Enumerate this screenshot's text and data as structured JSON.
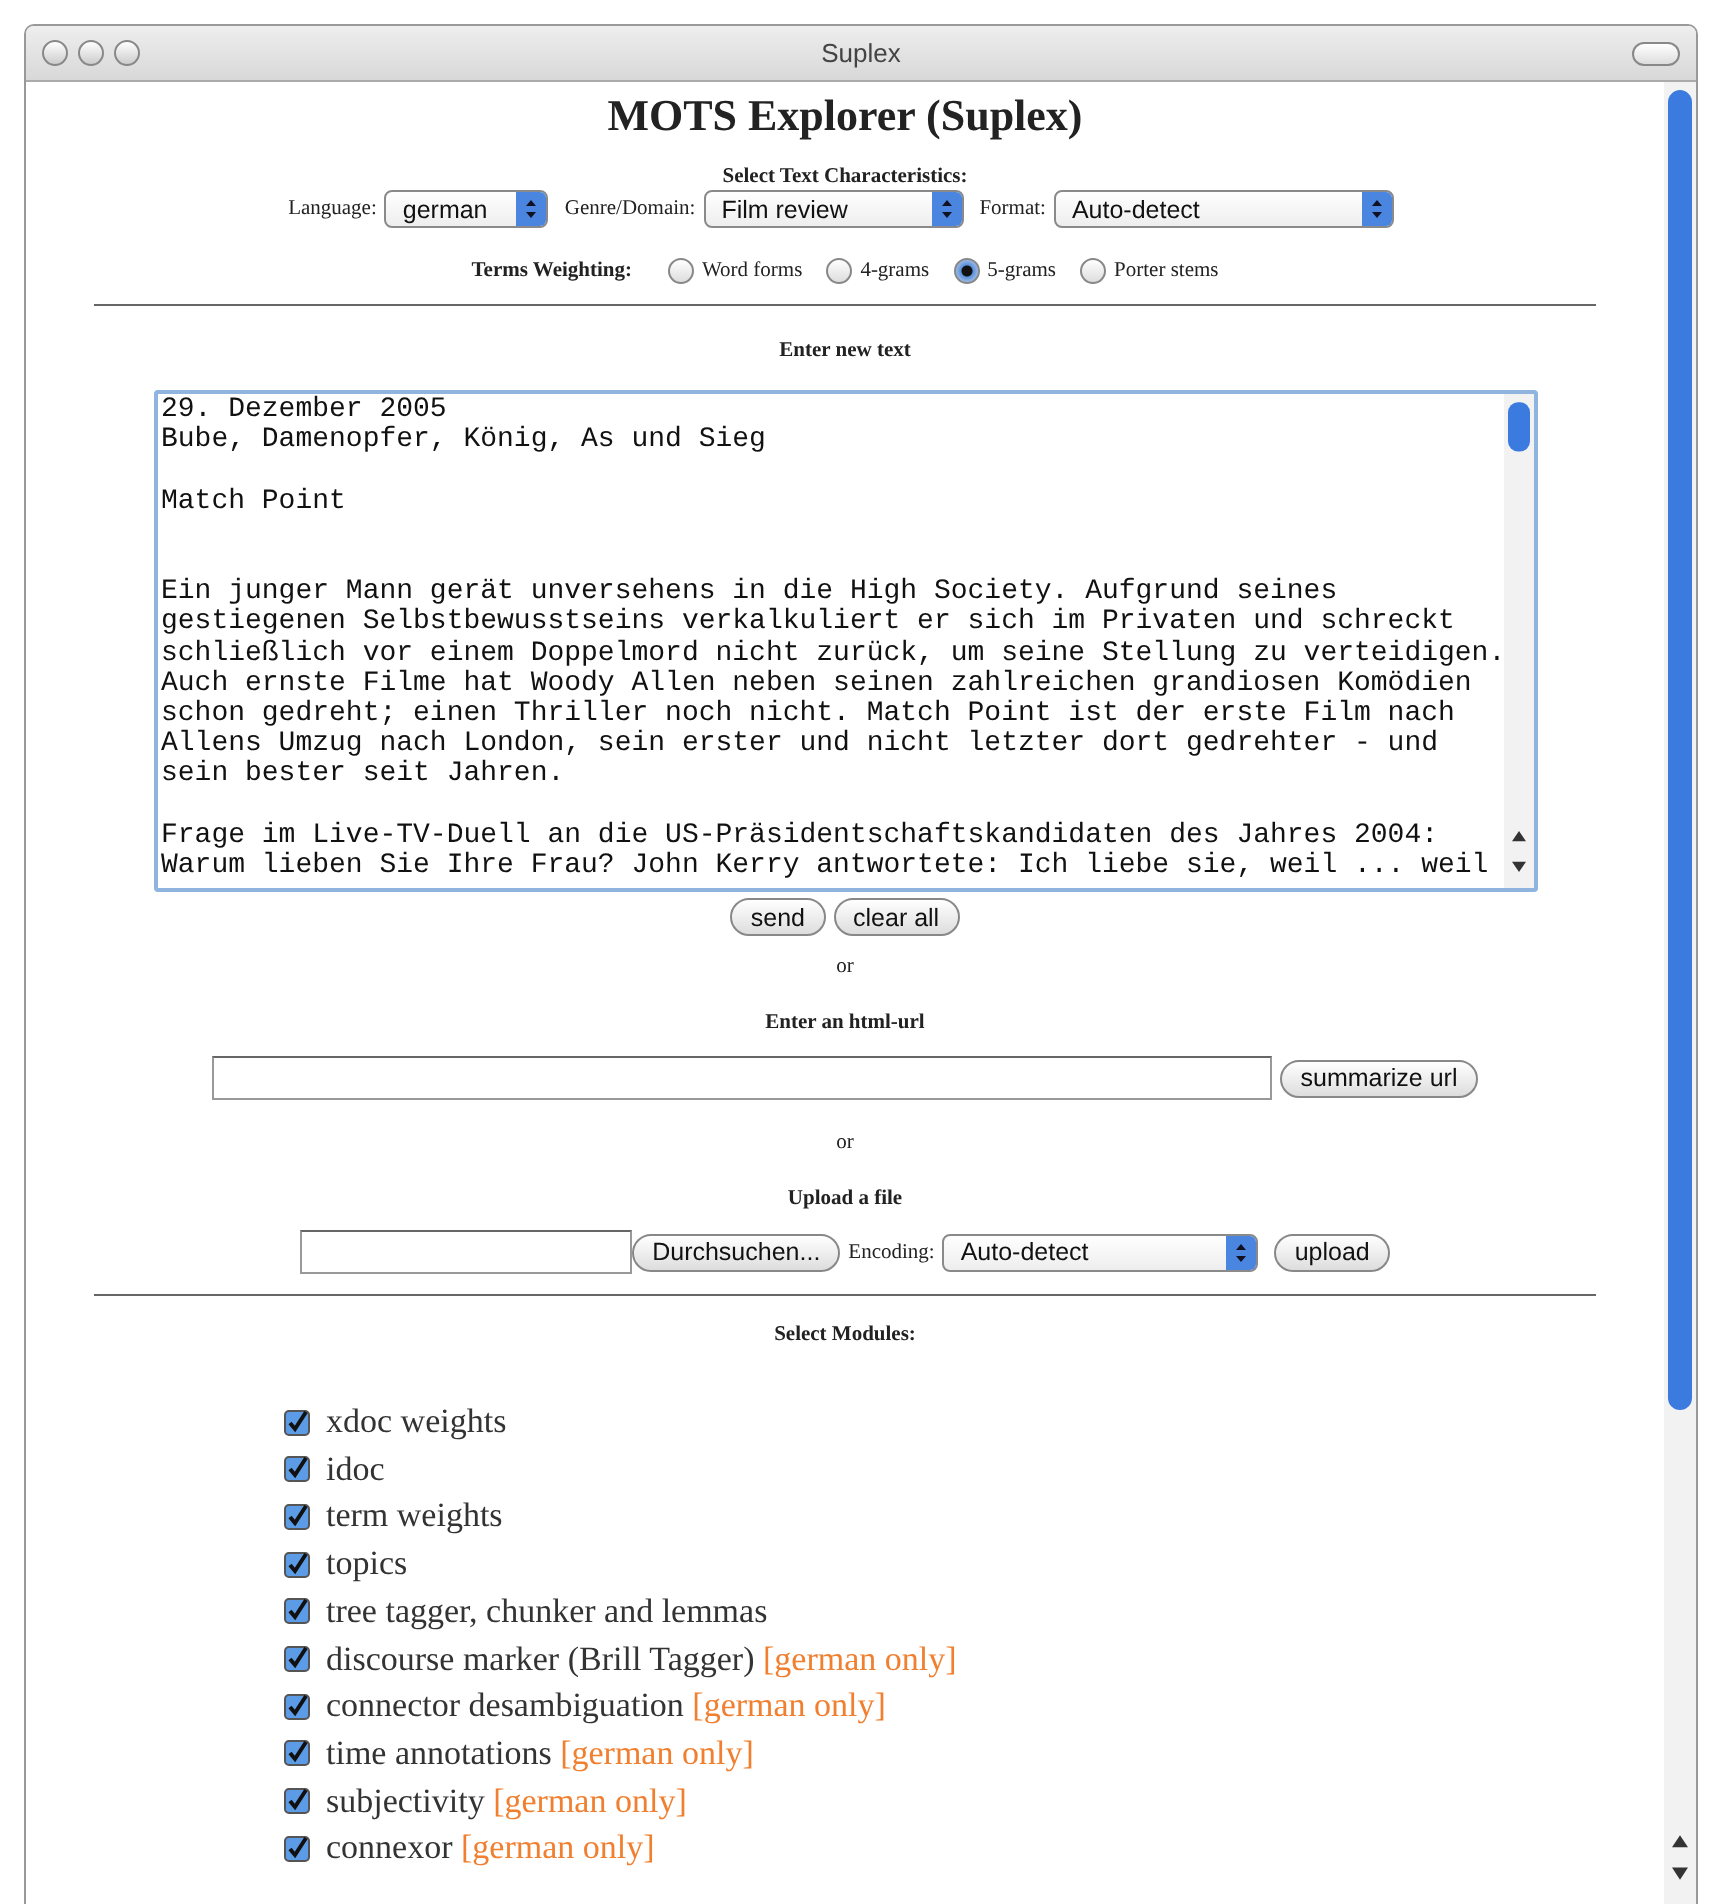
{
  "window": {
    "title": "Suplex"
  },
  "heading": "MOTS Explorer (Suplex)",
  "characteristics": {
    "title": "Select Text Characteristics:",
    "selects": [
      {
        "label": "Language:",
        "value": "german",
        "kind": "narrow"
      },
      {
        "label": "Genre/Domain:",
        "value": "Film review",
        "kind": "medium"
      },
      {
        "label": "Format:",
        "value": "Auto-detect",
        "kind": "wide"
      }
    ]
  },
  "weighting": {
    "label": "Terms Weighting:",
    "options": [
      {
        "label": "Word forms",
        "selected": false
      },
      {
        "label": "4-grams",
        "selected": false
      },
      {
        "label": "5-grams",
        "selected": true
      },
      {
        "label": "Porter stems",
        "selected": false
      }
    ]
  },
  "text_section": {
    "title": "Enter new text",
    "text": "29. Dezember 2005\nBube, Damenopfer, König, As und Sieg\n\nMatch Point\n\n\nEin junger Mann gerät unversehens in die High Society. Aufgrund seines\ngestiegenen Selbstbewusstseins verkalkuliert er sich im Privaten und schreckt\nschließlich vor einem Doppelmord nicht zurück, um seine Stellung zu verteidigen.\nAuch ernste Filme hat Woody Allen neben seinen zahlreichen grandiosen Komödien\nschon gedreht; einen Thriller noch nicht. Match Point ist der erste Film nach\nAllens Umzug nach London, sein erster und nicht letzter dort gedrehter - und\nsein bester seit Jahren.\n\nFrage im Live-TV-Duell an die US-Präsidentschaftskandidaten des Jahres 2004:\nWarum lieben Sie Ihre Frau? John Kerry antwortete: Ich liebe sie, weil ... weil",
    "buttons": [
      "send",
      "clear all"
    ]
  },
  "or_1": "or",
  "url_section": {
    "title": "Enter an html-url",
    "button": "summarize url"
  },
  "or_2": "or",
  "upload_section": {
    "title": "Upload a file",
    "browse_button": "Durchsuchen...",
    "encoding_label": "Encoding:",
    "encoding_value": "Auto-detect",
    "upload_button": "upload"
  },
  "modules": {
    "title": "Select Modules:",
    "items": [
      {
        "label": "xdoc weights",
        "checked": true
      },
      {
        "label": "idoc",
        "checked": true
      },
      {
        "label": "term weights",
        "checked": true
      },
      {
        "label": "topics",
        "checked": true
      },
      {
        "label": "tree tagger, chunker and lemmas",
        "checked": true
      },
      {
        "label": "discourse marker (Brill Tagger)",
        "note": "[german only]",
        "checked": true
      },
      {
        "label": "connector desambiguation",
        "note": "[german only]",
        "checked": true
      },
      {
        "label": "time annotations",
        "note": "[german only]",
        "checked": true
      },
      {
        "label": "subjectivity",
        "note": "[german only]",
        "checked": true
      },
      {
        "label": "connexor",
        "note": "[german only]",
        "checked": true
      }
    ]
  }
}
